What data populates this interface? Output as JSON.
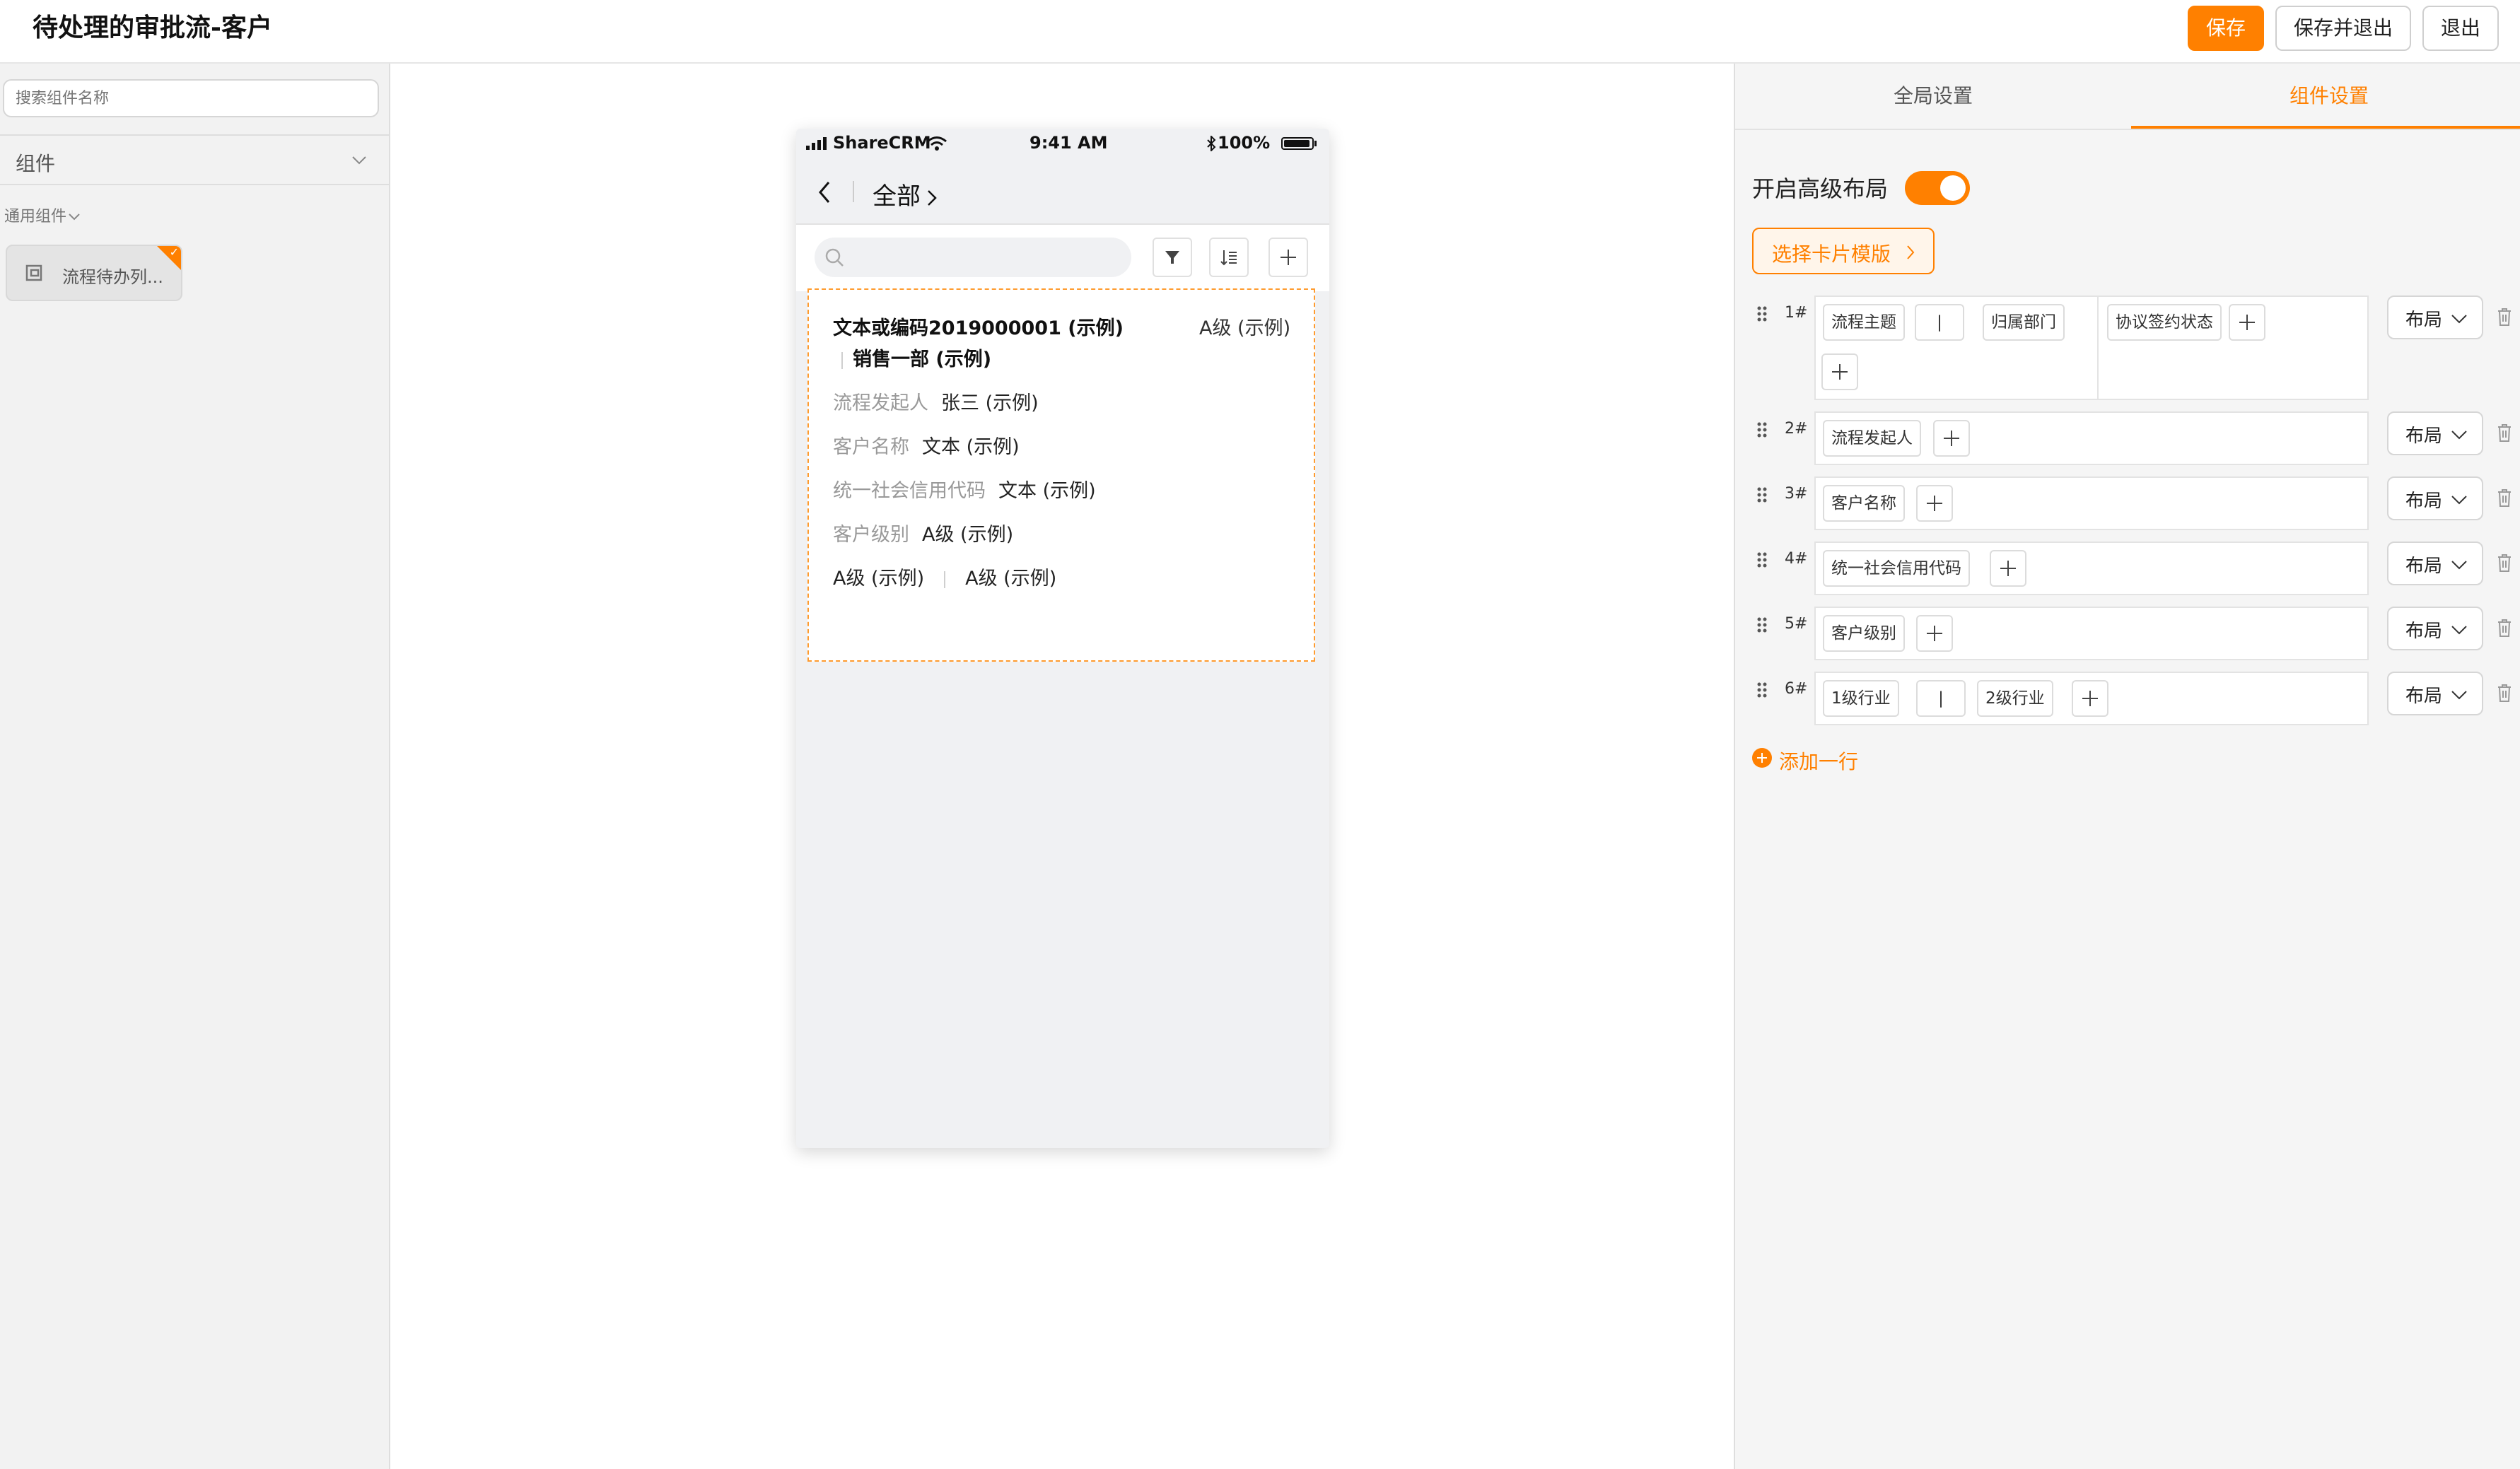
{
  "header": {
    "title": "待处理的审批流-客户",
    "buttons": {
      "save": "保存",
      "save_exit": "保存并退出",
      "exit": "退出"
    }
  },
  "left_panel": {
    "search_placeholder": "搜索组件名称",
    "dropdown_label": "组件",
    "section_label": "通用组件",
    "component_card": "流程待办列..."
  },
  "phone": {
    "status": {
      "carrier": "ShareCRM",
      "time": "9:41 AM",
      "battery": "100%"
    },
    "nav": {
      "title": "全部"
    },
    "card": {
      "title_line": "文本或编码2019000001 (示例)",
      "level_right": "A级 (示例)",
      "department": "销售一部 (示例)",
      "fields": [
        {
          "label": "流程发起人",
          "value": "张三 (示例)"
        },
        {
          "label": "客户名称",
          "value": "文本 (示例)"
        },
        {
          "label": "统一社会信用代码",
          "value": "文本 (示例)"
        },
        {
          "label": "客户级别",
          "value": "A级 (示例)"
        }
      ],
      "bottom_left": "A级 (示例)",
      "bottom_right": "A级 (示例)"
    }
  },
  "right_panel": {
    "tabs": [
      "全局设置",
      "组件设置"
    ],
    "active_tab": 1,
    "toggle_label": "开启高级布局",
    "toggle_on": true,
    "template_button": "选择卡片模版",
    "rows": [
      {
        "num": "1#",
        "chips": [
          "流程主题",
          "|",
          "归属部门",
          "协议签约状态"
        ]
      },
      {
        "num": "2#",
        "chips": [
          "流程发起人"
        ]
      },
      {
        "num": "3#",
        "chips": [
          "客户名称"
        ]
      },
      {
        "num": "4#",
        "chips": [
          "统一社会信用代码"
        ]
      },
      {
        "num": "5#",
        "chips": [
          "客户级别"
        ]
      },
      {
        "num": "6#",
        "chips": [
          "1级行业",
          "|",
          "2级行业"
        ]
      }
    ],
    "layout_button": "布局",
    "add_row": "添加一行"
  },
  "colors": {
    "accent": "#ff8000",
    "dashed_border": "#ff9b2e",
    "label_gray": "#999999"
  },
  "icons": [
    "chevron-down-icon",
    "component-icon",
    "check-icon",
    "signal-icon",
    "wifi-icon",
    "bluetooth-icon",
    "battery-icon",
    "back-icon",
    "chevron-right-icon",
    "search-icon",
    "filter-icon",
    "sort-icon",
    "plus-icon",
    "drag-handle-icon",
    "trash-icon",
    "add-circle-icon"
  ]
}
